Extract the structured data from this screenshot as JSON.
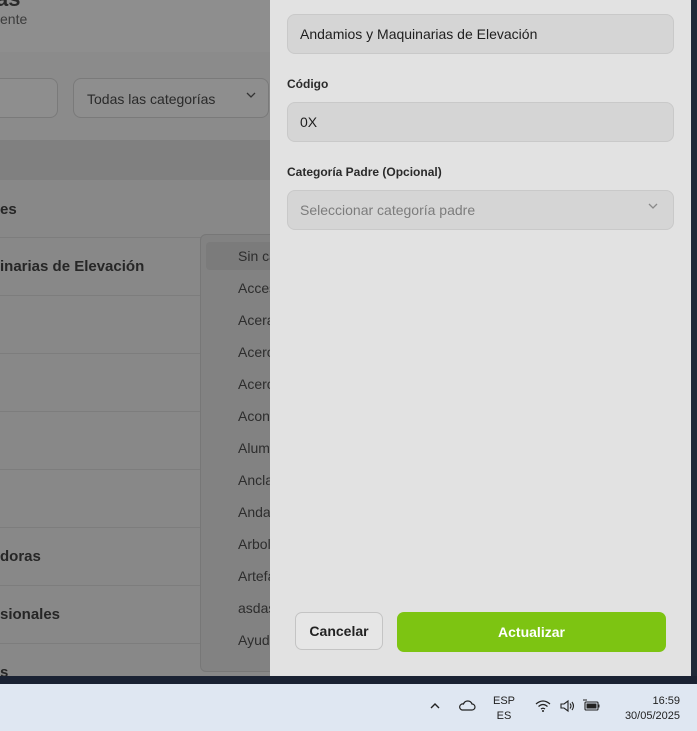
{
  "background_app": {
    "title_fragment": "as",
    "subtitle_fragment": "ente",
    "category_filter": "Todas las categorías",
    "section_header": "es",
    "rows": [
      "inarias de Elevación",
      "",
      "",
      "",
      "",
      "doras",
      "sionales",
      "s"
    ],
    "dropdown_items": [
      "Sin ca",
      "Acces",
      "Acera",
      "Acerc",
      "Acerc",
      "Aconc",
      "Alum",
      "Ancla",
      "Anda",
      "Arbol",
      "Artefa",
      "asdas",
      "Ayud"
    ]
  },
  "drawer": {
    "name_value": "Andamios y Maquinarias de Elevación",
    "code_label": "Código",
    "code_value": "0X",
    "parent_label": "Categoría Padre (Opcional)",
    "parent_placeholder": "Seleccionar categoría padre",
    "cancel_label": "Cancelar",
    "update_label": "Actualizar",
    "accent_color": "#7dc412"
  },
  "taskbar": {
    "lang_line1": "ESP",
    "lang_line2": "ES",
    "time": "16:59",
    "date": "30/05/2025",
    "icons": [
      "chevron-up-icon",
      "cloud-icon",
      "wifi-icon",
      "speaker-icon",
      "battery-icon"
    ]
  }
}
